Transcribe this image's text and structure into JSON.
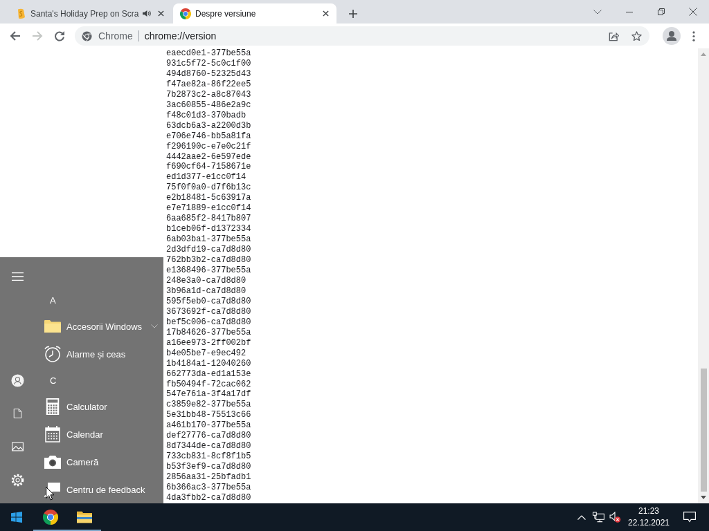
{
  "tabs": [
    {
      "title": "Santa's Holiday Prep on Scra",
      "selected": false,
      "playing_audio": true
    },
    {
      "title": "Despre versiune",
      "selected": true,
      "playing_audio": false
    }
  ],
  "toolbar": {
    "back_enabled": true,
    "forward_enabled": false,
    "site_label": "Chrome",
    "url": "chrome://version"
  },
  "page": {
    "lines": [
      "eaecd0e1-377be55a",
      "931c5f72-5c0c1f00",
      "494d8760-52325d43",
      "f47ae82a-86f22ee5",
      "7b2873c2-a8c87043",
      "3ac60855-486e2a9c",
      "f48c01d3-370badb",
      "63dcb6a3-a2200d3b",
      "e706e746-bb5a81fa",
      "f296190c-e7e0c21f",
      "4442aae2-6e597ede",
      "f690cf64-7158671e",
      "ed1d377-e1cc0f14",
      "75f0f0a0-d7f6b13c",
      "e2b18481-5c63917a",
      "e7e71889-e1cc0f14",
      "6aa685f2-8417b807",
      "b1ceb06f-d1372334",
      "6ab03ba1-377be55a",
      "2d3dfd19-ca7d8d80",
      "762bb3b2-ca7d8d80",
      "e1368496-377be55a",
      "248e3a0-ca7d8d80",
      "3b96a1d-ca7d8d80",
      "595f5eb0-ca7d8d80",
      "3673692f-ca7d8d80",
      "bef5c006-ca7d8d80",
      "17b84626-377be55a",
      "a16ee973-2ff002bf",
      "b4e05be7-e9ec492",
      "1b4184a1-12040260",
      "662773da-ed1a153e",
      "fb50494f-72cac062",
      "547e761a-3f4a17df",
      "c3859e82-377be55a",
      "5e31bb48-75513c66",
      "a461b170-377be55a",
      "def27776-ca7d8d80",
      "8d7344de-ca7d8d80",
      "733cb831-8cf8f1b5",
      "b53f3ef9-ca7d8d80",
      "2856aa31-25bfadb1",
      "6b366ac3-377be55a",
      "4da3fbb2-ca7d8d80"
    ]
  },
  "start_menu": {
    "sections": [
      {
        "letter": "A",
        "apps": [
          {
            "name": "Accesorii Windows",
            "kind": "folder",
            "expanded": false
          },
          {
            "name": "Alarme și ceas",
            "kind": "app"
          }
        ]
      },
      {
        "letter": "C",
        "apps": [
          {
            "name": "Calculator",
            "kind": "app"
          },
          {
            "name": "Calendar",
            "kind": "app"
          },
          {
            "name": "Cameră",
            "kind": "app"
          },
          {
            "name": "Centru de feedback",
            "kind": "app"
          }
        ]
      }
    ]
  },
  "taskbar": {
    "apps": [
      {
        "running": true
      },
      {
        "running": true
      }
    ],
    "volume_muted": true,
    "time": "21:23",
    "date": "22.12.2021"
  }
}
